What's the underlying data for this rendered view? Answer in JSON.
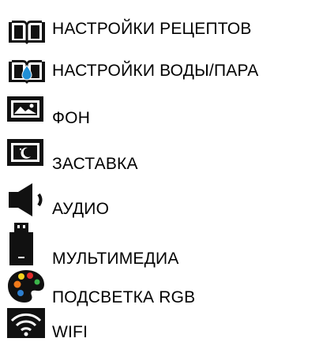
{
  "menu": {
    "items": [
      {
        "id": "recipes",
        "label": "НАСТРОЙКИ РЕЦЕПТОВ",
        "icon": "book-icon"
      },
      {
        "id": "water-steam",
        "label": "НАСТРОЙКИ ВОДЫ/ПАРА",
        "icon": "book-water-drop-icon"
      },
      {
        "id": "background",
        "label": "ФОН",
        "icon": "picture-icon"
      },
      {
        "id": "screensaver",
        "label": "ЗАСТАВКА",
        "icon": "screensaver-icon"
      },
      {
        "id": "audio",
        "label": "АУДИО",
        "icon": "speaker-icon"
      },
      {
        "id": "multimedia",
        "label": "МУЛЬТИМЕДИА",
        "icon": "usb-drive-icon"
      },
      {
        "id": "rgb",
        "label": "ПОДСВЕТКА RGB",
        "icon": "palette-icon"
      },
      {
        "id": "wifi",
        "label": "WIFI",
        "icon": "wifi-icon"
      }
    ]
  },
  "colors": {
    "text": "#000000",
    "icon_dark": "#111111",
    "water_drop": "#1f8fd6",
    "palette_orange": "#f07a1a",
    "palette_red": "#e22b2b",
    "palette_green": "#3cb44a",
    "palette_blue": "#2d7fd0",
    "palette_yellow": "#f5d21e"
  }
}
